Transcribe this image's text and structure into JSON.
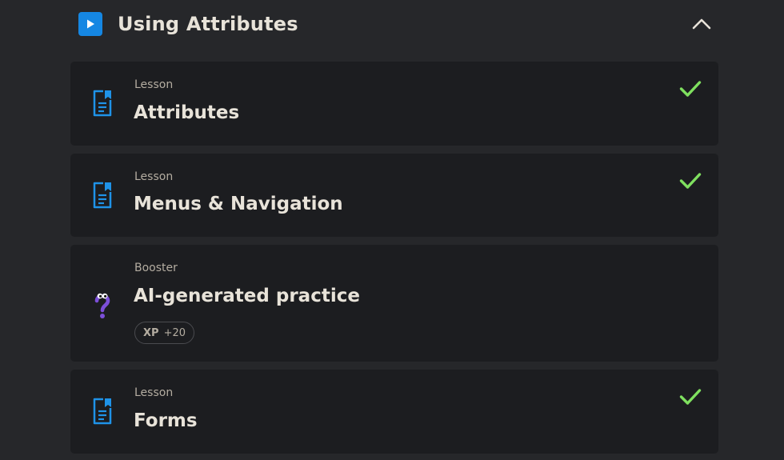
{
  "section": {
    "title": "Using Attributes",
    "icons": {
      "play": "play-icon",
      "toggle": "chevron-up-icon"
    },
    "accent": "#1587e3"
  },
  "items": [
    {
      "kind": "Lesson",
      "title": "Attributes",
      "icon": "lesson-document-icon",
      "completed": true
    },
    {
      "kind": "Lesson",
      "title": "Menus & Navigation",
      "icon": "lesson-document-icon",
      "completed": true
    },
    {
      "kind": "Booster",
      "title": "AI-generated practice",
      "icon": "question-mascot-icon",
      "completed": false,
      "xp": {
        "label": "XP",
        "value": "+20"
      }
    },
    {
      "kind": "Lesson",
      "title": "Forms",
      "icon": "lesson-document-icon",
      "completed": true
    }
  ],
  "colors": {
    "background": "#26272a",
    "card": "#1c1d20",
    "check": "#7fe05f",
    "lesson_icon": "#1f93e8",
    "booster_icon": "#7c4fd8"
  }
}
